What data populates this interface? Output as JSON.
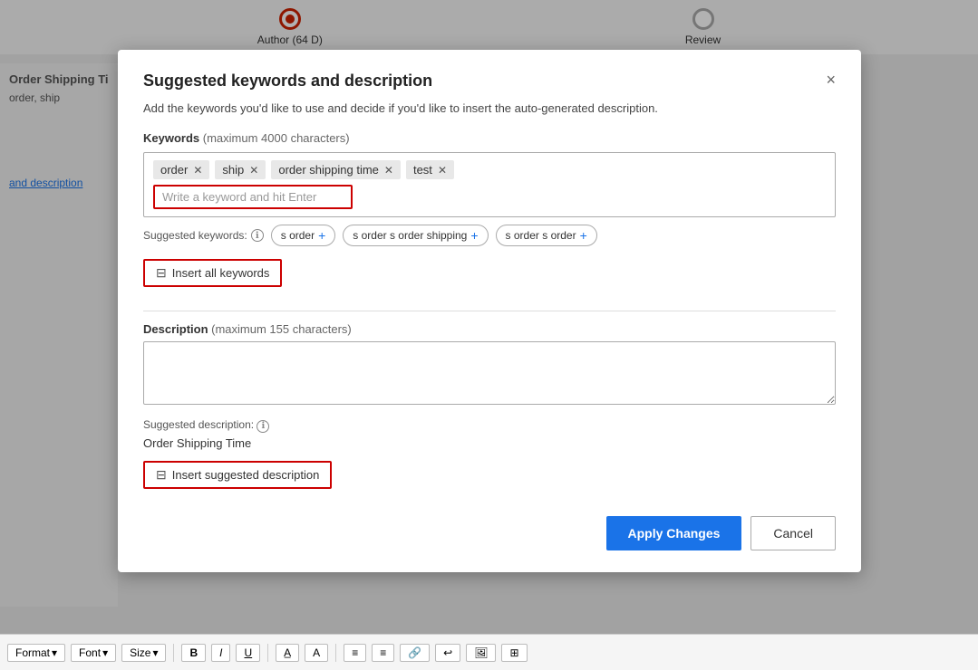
{
  "background": {
    "color": "#e0e0e0"
  },
  "progress": {
    "steps": [
      {
        "id": "author",
        "label": "Author (64 D)",
        "active": true
      },
      {
        "id": "review",
        "label": "Review",
        "active": false
      }
    ]
  },
  "left_panel": {
    "title": "Order Shipping Time",
    "subtitle": "order, ship",
    "link_text": "and description"
  },
  "modal": {
    "title": "Suggested keywords and description",
    "close_label": "×",
    "subtitle": "Add the keywords you'd like to use and decide if you'd like to insert the auto-generated description.",
    "keywords_section": {
      "label": "Keywords",
      "sublabel": "(maximum 4000 characters)",
      "tags": [
        {
          "id": "tag-order",
          "text": "order"
        },
        {
          "id": "tag-ship",
          "text": "ship"
        },
        {
          "id": "tag-order-shipping-time",
          "text": "order shipping time"
        },
        {
          "id": "tag-test",
          "text": "test"
        }
      ],
      "input_placeholder": "Write a keyword and hit Enter",
      "suggested_label": "Suggested keywords:",
      "suggested_chips": [
        {
          "id": "chip-sorder",
          "text": "s order"
        },
        {
          "id": "chip-sordersordershipping",
          "text": "s order s order shipping"
        },
        {
          "id": "chip-sordersorder",
          "text": "s order s order"
        }
      ],
      "insert_all_btn": "Insert all keywords",
      "insert_all_icon": "⊟"
    },
    "description_section": {
      "label": "Description",
      "sublabel": "(maximum 155 characters)",
      "textarea_value": "",
      "textarea_placeholder": "",
      "suggested_label": "Suggested description:",
      "suggested_text": "Order Shipping Time",
      "insert_btn": "Insert suggested description",
      "insert_icon": "⊟"
    },
    "footer": {
      "apply_label": "Apply Changes",
      "cancel_label": "Cancel"
    }
  },
  "toolbar": {
    "format_label": "Format",
    "font_label": "Font",
    "size_label": "Size",
    "bold_label": "B",
    "italic_label": "I",
    "underline_label": "U"
  }
}
